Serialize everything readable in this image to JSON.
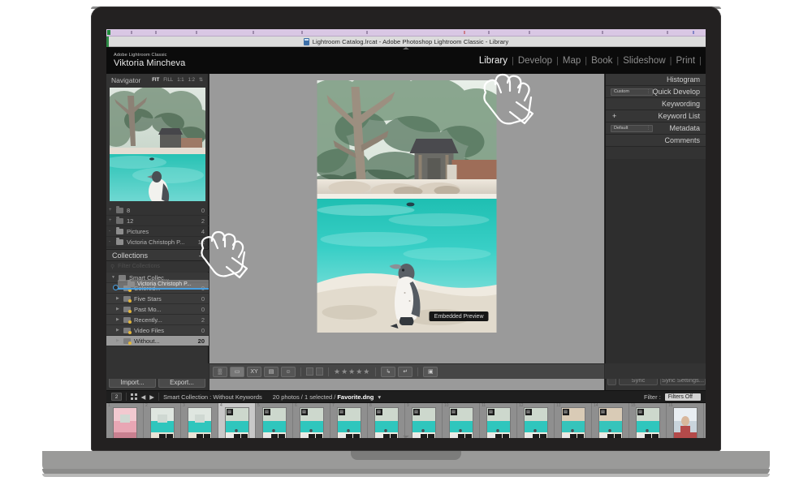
{
  "window": {
    "title": "Lightroom Catalog.lrcat - Adobe Photoshop Lightroom Classic - Library",
    "title_icon": "lightroom-catalog-icon"
  },
  "identity": {
    "app_name": "Adobe Lightroom Classic",
    "user_name": "Viktoria Mincheva"
  },
  "module_picker": {
    "modules": [
      {
        "label": "Library",
        "active": true
      },
      {
        "label": "Develop",
        "active": false
      },
      {
        "label": "Map",
        "active": false
      },
      {
        "label": "Book",
        "active": false
      },
      {
        "label": "Slideshow",
        "active": false
      },
      {
        "label": "Print",
        "active": false
      }
    ],
    "separator": "|"
  },
  "navigator": {
    "title": "Navigator",
    "modes": [
      "FIT",
      "FILL",
      "1:1",
      "1:2"
    ],
    "active_mode": "FIT"
  },
  "folders": [
    {
      "name": "8",
      "count": "0",
      "dim": true
    },
    {
      "name": "12",
      "count": "2",
      "dim": true
    },
    {
      "name": "Pictures",
      "count": "4",
      "dim": false
    },
    {
      "name": "Victoria Christoph P...",
      "count": "12",
      "dim": false
    }
  ],
  "collections": {
    "title": "Collections",
    "collapse_glyph": "–",
    "filter_placeholder": "Filter Collections",
    "filter_icon": "search-icon",
    "root": {
      "label": "Smart Collec...",
      "count": ""
    },
    "drag_ghost_label": "Victoria Christoph P...",
    "items": [
      {
        "label": "Colored...",
        "count": "0",
        "selected": false
      },
      {
        "label": "Five Stars",
        "count": "0",
        "selected": false
      },
      {
        "label": "Past Mo...",
        "count": "0",
        "selected": false
      },
      {
        "label": "Recently...",
        "count": "2",
        "selected": false
      },
      {
        "label": "Video Files",
        "count": "0",
        "selected": false
      },
      {
        "label": "Without...",
        "count": "20",
        "selected": true
      }
    ]
  },
  "left_buttons": {
    "import": "Import...",
    "export": "Export..."
  },
  "preview": {
    "badge": "Embedded Preview",
    "alt": "penguin-standing-by-turquoise-pool"
  },
  "right_panel": {
    "rows": [
      {
        "label": "Histogram",
        "control": null
      },
      {
        "label": "Quick Develop",
        "control": "Custom"
      },
      {
        "label": "Keywording",
        "control": null
      },
      {
        "label": "Keyword List",
        "control": "+"
      },
      {
        "label": "Metadata",
        "control": "Default"
      },
      {
        "label": "Comments",
        "control": null
      }
    ],
    "sync_button": "Sync",
    "sync_settings_button": "Sync Settings..."
  },
  "toolbar": {
    "view_modes": [
      {
        "name": "grid-view-icon",
        "glyph": "▒",
        "active": false
      },
      {
        "name": "loupe-view-icon",
        "glyph": "▭",
        "active": true
      },
      {
        "name": "compare-view-icon",
        "glyph": "XY",
        "active": false
      },
      {
        "name": "survey-view-icon",
        "glyph": "▤",
        "active": false
      },
      {
        "name": "people-view-icon",
        "glyph": "☺",
        "active": false
      }
    ],
    "flag_icons": [
      "flag-pick-icon",
      "flag-reject-icon"
    ],
    "rating_stars": "★★★★★",
    "rotate_left_icon": "rotate-left-icon",
    "rotate_right_icon": "rotate-right-icon",
    "crop_overlay_icon": "crop-overlay-icon"
  },
  "filmstrip_bar": {
    "monitor_number": "2",
    "grid_icon": "grid-icon",
    "back_arrow": "◀",
    "forward_arrow": "▶",
    "source": "Smart Collection : Without Keywords",
    "photo_count": "20 photos / 1 selected /",
    "active_file": "Favorite.dng",
    "dropdown_glyph": "▾",
    "filter_label": "Filter :",
    "filter_value": "Filters Off"
  },
  "filmstrip": {
    "selected_index": 4,
    "thumbs": [
      {
        "num": "1",
        "kind": "pink"
      },
      {
        "num": "2",
        "kind": "pool"
      },
      {
        "num": "3",
        "kind": "pool"
      },
      {
        "num": "4",
        "kind": "penguin"
      },
      {
        "num": "5",
        "kind": "penguin"
      },
      {
        "num": "6",
        "kind": "penguin"
      },
      {
        "num": "7",
        "kind": "penguin"
      },
      {
        "num": "8",
        "kind": "penguin"
      },
      {
        "num": "9",
        "kind": "penguin"
      },
      {
        "num": "10",
        "kind": "penguin"
      },
      {
        "num": "11",
        "kind": "penguin"
      },
      {
        "num": "12",
        "kind": "penguin"
      },
      {
        "num": "13",
        "kind": "penguin-warm"
      },
      {
        "num": "14",
        "kind": "penguin-warm"
      },
      {
        "num": "15",
        "kind": "penguin"
      },
      {
        "num": "16",
        "kind": "portrait"
      },
      {
        "num": "17",
        "kind": "portrait"
      },
      {
        "num": "18",
        "kind": "portrait-walk"
      }
    ]
  },
  "colors": {
    "panel_bg": "#333333",
    "center_bg": "#9a9a9a",
    "accent_blue": "#49a0e0",
    "smart_badge": "#e0b43c",
    "selection": "#9b9b9b"
  }
}
